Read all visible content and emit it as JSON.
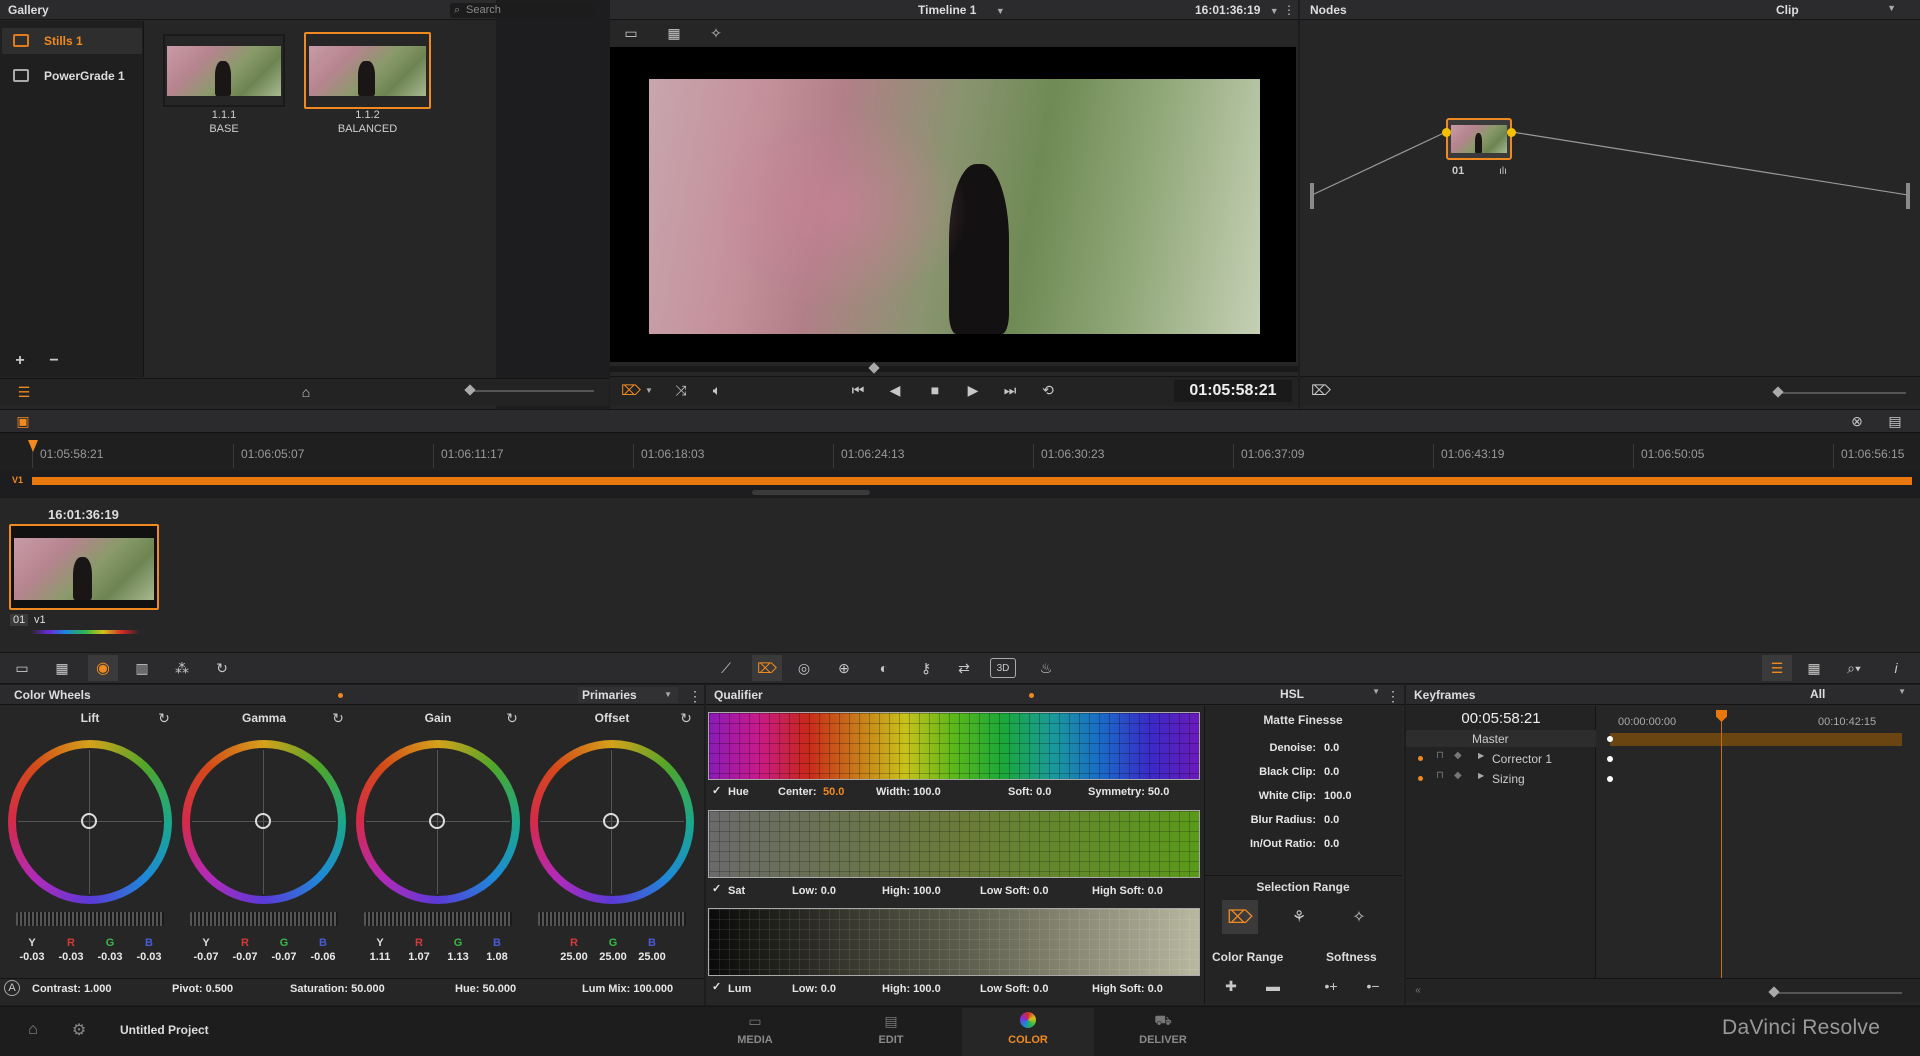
{
  "gallery": {
    "title": "Gallery",
    "search_placeholder": "Search",
    "albums": [
      "Stills 1",
      "PowerGrade 1"
    ],
    "stills": [
      {
        "id": "1.1.1",
        "name": "BASE"
      },
      {
        "id": "1.1.2",
        "name": "BALANCED"
      }
    ]
  },
  "viewer": {
    "timeline_name": "Timeline 1",
    "source_tc": "16:01:36:19",
    "record_tc": "01:05:58:21"
  },
  "nodes": {
    "title": "Nodes",
    "mode": "Clip",
    "node_label": "01"
  },
  "timeline": {
    "ruler": [
      "01:05:58:21",
      "01:06:05:07",
      "01:06:11:17",
      "01:06:18:03",
      "01:06:24:13",
      "01:06:30:23",
      "01:06:37:09",
      "01:06:43:19",
      "01:06:50:05",
      "01:06:56:15"
    ],
    "track": "V1",
    "clip_tc": "16:01:36:19",
    "clip_num": "01",
    "clip_track": "v1"
  },
  "color_wheels": {
    "title": "Color Wheels",
    "mode": "Primaries",
    "wheels": [
      {
        "name": "Lift",
        "labels": [
          "Y",
          "R",
          "G",
          "B"
        ],
        "values": [
          "-0.03",
          "-0.03",
          "-0.03",
          "-0.03"
        ]
      },
      {
        "name": "Gamma",
        "labels": [
          "Y",
          "R",
          "G",
          "B"
        ],
        "values": [
          "-0.07",
          "-0.07",
          "-0.07",
          "-0.06"
        ]
      },
      {
        "name": "Gain",
        "labels": [
          "Y",
          "R",
          "G",
          "B"
        ],
        "values": [
          "1.11",
          "1.07",
          "1.13",
          "1.08"
        ]
      },
      {
        "name": "Offset",
        "labels": [
          "R",
          "G",
          "B"
        ],
        "values": [
          "25.00",
          "25.00",
          "25.00"
        ]
      }
    ],
    "footer": {
      "contrast": "Contrast: 1.000",
      "pivot": "Pivot: 0.500",
      "saturation": "Saturation: 50.000",
      "hue": "Hue: 50.000",
      "lum_mix": "Lum Mix: 100.000"
    }
  },
  "qualifier": {
    "title": "Qualifier",
    "mode": "HSL",
    "hue": {
      "name": "Hue",
      "center_label": "Center:",
      "center": "50.0",
      "width": "Width: 100.0",
      "soft": "Soft: 0.0",
      "symmetry": "Symmetry: 50.0"
    },
    "sat": {
      "name": "Sat",
      "low": "Low: 0.0",
      "high": "High: 100.0",
      "low_soft": "Low Soft: 0.0",
      "high_soft": "High Soft: 0.0"
    },
    "lum": {
      "name": "Lum",
      "low": "Low: 0.0",
      "high": "High: 100.0",
      "low_soft": "Low Soft: 0.0",
      "high_soft": "High Soft: 0.0"
    }
  },
  "matte": {
    "title": "Matte Finesse",
    "rows": [
      {
        "label": "Denoise:",
        "value": "0.0"
      },
      {
        "label": "Black Clip:",
        "value": "0.0"
      },
      {
        "label": "White Clip:",
        "value": "100.0"
      },
      {
        "label": "Blur Radius:",
        "value": "0.0"
      },
      {
        "label": "In/Out Ratio:",
        "value": "0.0"
      }
    ],
    "selection_range": "Selection Range",
    "color_range": "Color Range",
    "softness": "Softness"
  },
  "keyframes": {
    "title": "Keyframes",
    "filter": "All",
    "current_tc": "00:05:58:21",
    "ruler": [
      "00:00:00:00",
      "00:10:42:15"
    ],
    "tracks": [
      "Master",
      "Corrector 1",
      "Sizing"
    ]
  },
  "footer": {
    "project": "Untitled Project",
    "tabs": [
      "MEDIA",
      "EDIT",
      "COLOR",
      "DELIVER"
    ],
    "brand": "DaVinci Resolve"
  }
}
